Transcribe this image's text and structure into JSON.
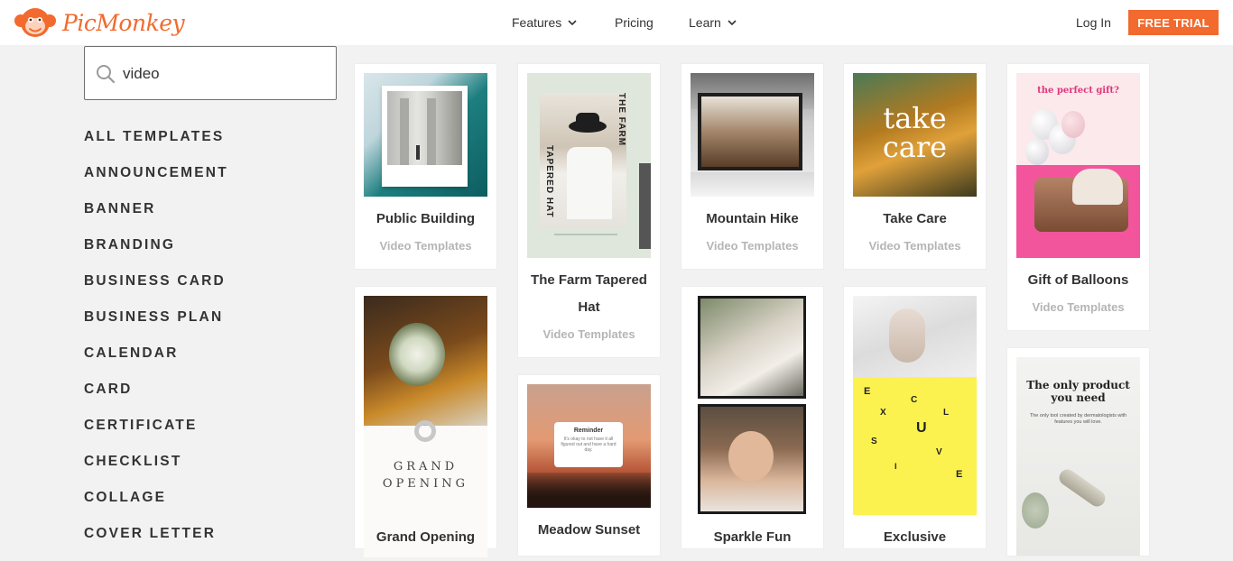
{
  "header": {
    "logo_text": "PicMonkey",
    "nav": [
      {
        "label": "Features"
      },
      {
        "label": "Pricing"
      },
      {
        "label": "Learn"
      }
    ],
    "login_label": "Log In",
    "trial_label": "FREE TRIAL",
    "brand_color": "#f26a2e"
  },
  "sidebar": {
    "search_value": "video",
    "categories": [
      "ALL TEMPLATES",
      "ANNOUNCEMENT",
      "BANNER",
      "BRANDING",
      "BUSINESS CARD",
      "BUSINESS PLAN",
      "CALENDAR",
      "CARD",
      "CERTIFICATE",
      "CHECKLIST",
      "COLLAGE",
      "COVER LETTER"
    ]
  },
  "cards": {
    "public_building": {
      "title": "Public Building",
      "sub": "Video Templates"
    },
    "farm_hat": {
      "title": "The Farm Tapered Hat",
      "sub": "Video Templates",
      "art_top": "THE FARM",
      "art_side": "TAPERED HAT"
    },
    "mountain_hike": {
      "title": "Mountain Hike",
      "sub": "Video Templates"
    },
    "take_care": {
      "title": "Take Care",
      "sub": "Video Templates",
      "art_line1": "take",
      "art_line2": "care"
    },
    "gift_balloons": {
      "title": "Gift of Balloons",
      "sub": "Video Templates",
      "art_heading": "the perfect gift?"
    },
    "grand_opening": {
      "title": "Grand Opening",
      "art_line1": "GRAND",
      "art_line2": "OPENING"
    },
    "meadow_sunset": {
      "title": "Meadow Sunset",
      "art_heading": "Reminder",
      "art_body": "It's okay to not have it all figured out and have a hard day."
    },
    "sparkle_fun": {
      "title": "Sparkle Fun"
    },
    "exclusive": {
      "title": "Exclusive",
      "art_letters": [
        "E",
        "X",
        "C",
        "L",
        "U",
        "S",
        "I",
        "V",
        "E"
      ]
    },
    "product": {
      "art_heading": "The only product you need",
      "art_body": "The only tool created by dermatologists with features you will love."
    }
  }
}
